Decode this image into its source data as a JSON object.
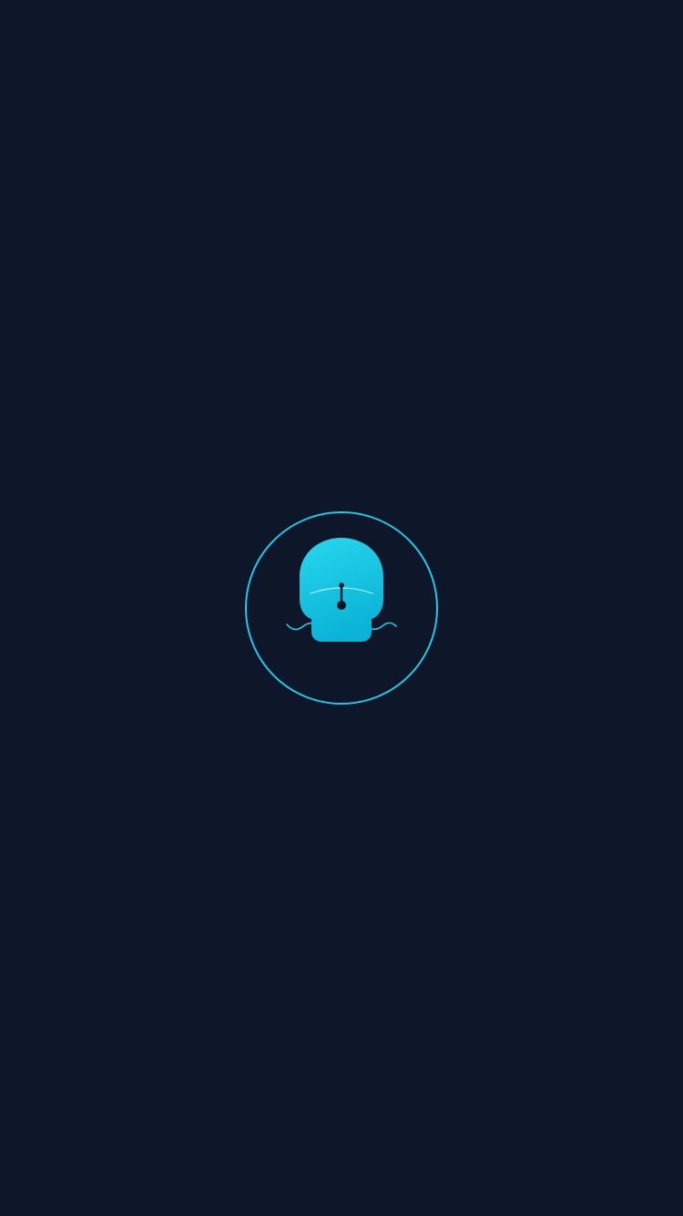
{
  "screen": {
    "type": "splash",
    "icon": "app-mascot-logo-icon"
  },
  "colors": {
    "background": "#0e1729",
    "accent": "#1ec8e6",
    "accent_dark": "#0bb3d6"
  }
}
